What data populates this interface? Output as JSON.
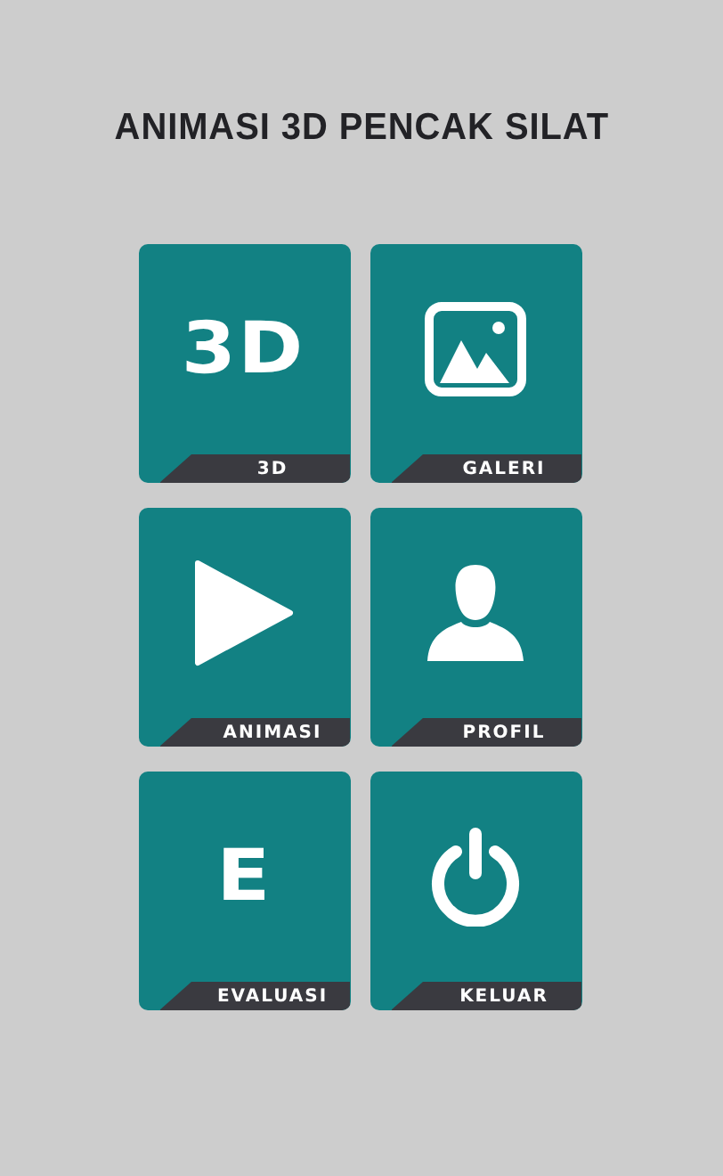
{
  "title": "ANIMASI 3D PENCAK SILAT",
  "tiles": [
    {
      "kind": "glyph",
      "glyph": "3D",
      "label": "3D"
    },
    {
      "kind": "gallery",
      "label": "GALERI"
    },
    {
      "kind": "play",
      "label": "ANIMASI"
    },
    {
      "kind": "person",
      "label": "PROFIL"
    },
    {
      "kind": "glyph",
      "glyph": "E",
      "label": "EVALUASI"
    },
    {
      "kind": "power",
      "label": "KELUAR"
    }
  ]
}
